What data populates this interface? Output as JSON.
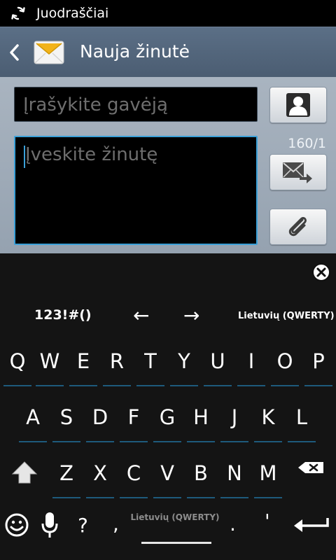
{
  "status_bar": {
    "title": "Juodraščiai",
    "icon": "sync-icon"
  },
  "action_bar": {
    "title": "Nauja žinutė",
    "back_icon": "back-chevron-icon",
    "app_icon": "message-envelope-icon"
  },
  "compose": {
    "recipient_placeholder": "Įrašykite gavėją",
    "message_placeholder": "Įveskite žinutę",
    "char_counter": "160/1",
    "buttons": {
      "contact": "contact-icon",
      "send": "send-icon",
      "attach": "paperclip-icon"
    },
    "accent_color": "#3aa0d8"
  },
  "keyboard": {
    "close_icon": "close-icon",
    "symbols_label": "123!#()",
    "left_arrow": "←",
    "right_arrow": "→",
    "language_label": "Lietuvių (QWERTY)",
    "row1": [
      "Q",
      "W",
      "E",
      "R",
      "T",
      "Y",
      "U",
      "I",
      "O",
      "P"
    ],
    "row2": [
      "A",
      "S",
      "D",
      "F",
      "G",
      "H",
      "J",
      "K",
      "L"
    ],
    "row3": [
      "Z",
      "X",
      "C",
      "V",
      "B",
      "N",
      "M"
    ],
    "bottom": {
      "question": "?",
      "comma": ",",
      "space_label": "Lietuvių (QWERTY)",
      "period": ".",
      "apostrophe": "'"
    }
  }
}
